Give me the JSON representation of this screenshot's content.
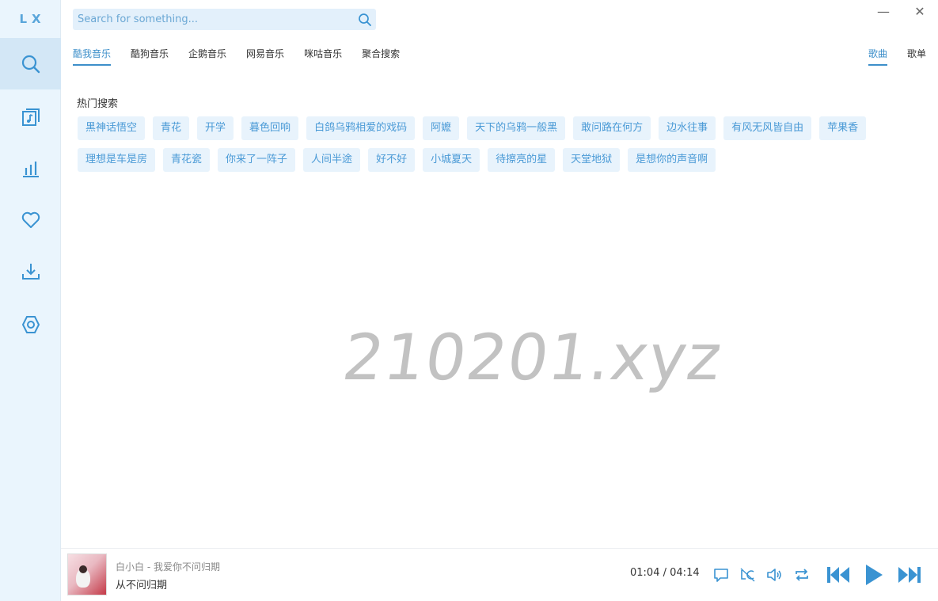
{
  "app": {
    "logo": "LX"
  },
  "window": {
    "minimize_label": "—",
    "close_label": "✕"
  },
  "search": {
    "placeholder": "Search for something..."
  },
  "sources": [
    "酷我音乐",
    "酷狗音乐",
    "企鹅音乐",
    "网易音乐",
    "咪咕音乐",
    "聚合搜索"
  ],
  "result_types": [
    "歌曲",
    "歌单"
  ],
  "hot": {
    "title": "热门搜索",
    "row1": [
      "黑神话悟空",
      "青花",
      "开学",
      "暮色回响",
      "白鸽乌鸦相爱的戏码",
      "阿嬷",
      "天下的乌鸦一般黑",
      "敢问路在何方",
      "边水往事",
      "有风无风皆自由",
      "苹果香"
    ],
    "row2": [
      "理想是车是房",
      "青花瓷",
      "你来了一阵子",
      "人间半途",
      "好不好",
      "小城夏天",
      "待擦亮的星",
      "天堂地狱",
      "是想你的声音啊"
    ]
  },
  "watermark": "210201.xyz",
  "player": {
    "artist_line": "白小白 - 我爱你不问归期",
    "title": "从不问归期",
    "current_time": "01:04",
    "separator": "/",
    "total_time": "04:14"
  },
  "colors": {
    "accent": "#3d8fca",
    "sidebar_bg": "#eaf5fd",
    "tag_bg": "#e8f3fc",
    "icon": "#3a93d2"
  }
}
